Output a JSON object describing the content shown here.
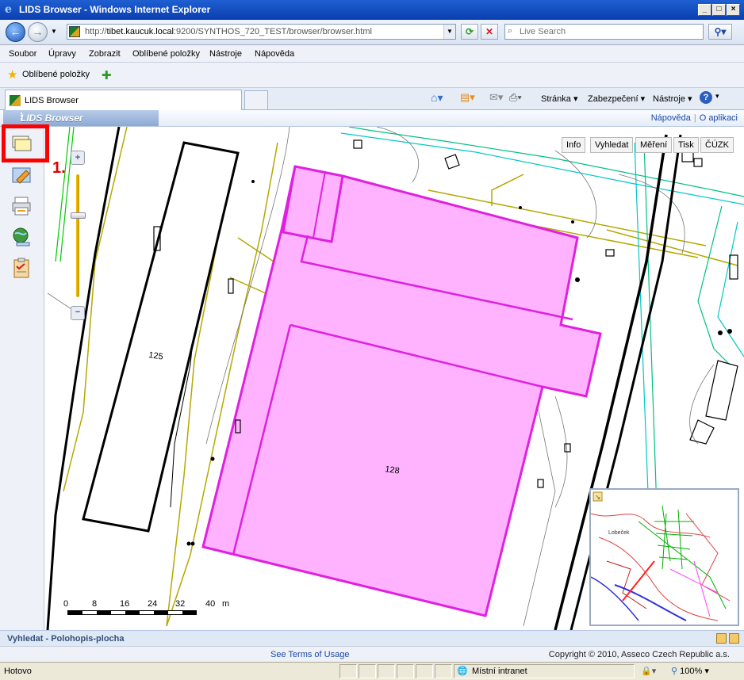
{
  "window": {
    "title": "LIDS Browser - Windows Internet Explorer",
    "url_prefix": "http://",
    "url_host": "tibet.kaucuk.local",
    "url_rest": ":9200/SYNTHOS_720_TEST/browser/browser.html",
    "search_placeholder": "Live Search"
  },
  "menu": [
    "Soubor",
    "Úpravy",
    "Zobrazit",
    "Oblíbené položky",
    "Nástroje",
    "Nápověda"
  ],
  "favorites": {
    "label": "Oblíbené položky"
  },
  "tab": {
    "label": "LIDS Browser"
  },
  "commandbar": {
    "page": "Stránka",
    "security": "Zabezpečení",
    "tools": "Nástroje"
  },
  "app": {
    "brand": "LIDS Browser",
    "help": "Nápověda",
    "about": "O aplikaci",
    "step_marker": "1."
  },
  "map_buttons": [
    "Info",
    "Vyhledat",
    "Měření",
    "Tisk",
    "ČÚZK"
  ],
  "map": {
    "building_label_1": "125",
    "building_label_2": "128",
    "overview_label": "Lobeček"
  },
  "scale": {
    "ticks": [
      "0",
      "8",
      "16",
      "24",
      "32",
      "40"
    ],
    "unit": "m"
  },
  "searchbar": {
    "title": "Vyhledat - Polohopis-plocha"
  },
  "footer": {
    "terms": "See Terms of Usage",
    "copyright": "Copyright © 2010, Asseco Czech Republic a.s."
  },
  "status": {
    "text": "Hotovo",
    "zone": "Místní intranet",
    "zoom": "100%"
  },
  "colors": {
    "parcel_fill": "#ffb3ff",
    "parcel_stroke": "#e020e0",
    "highlight": "#ff0000"
  }
}
